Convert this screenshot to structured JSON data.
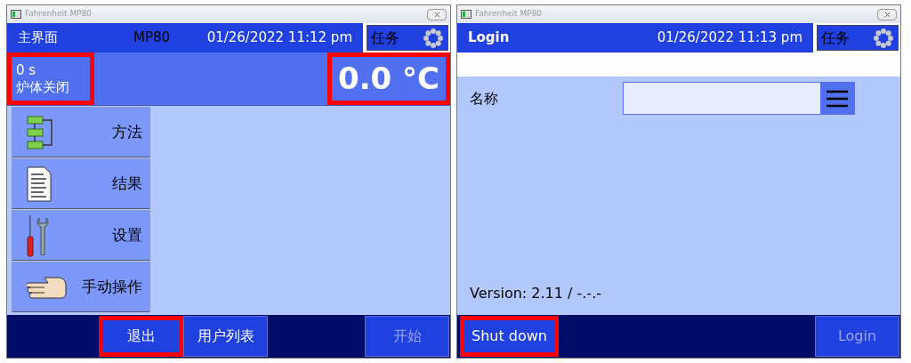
{
  "windows": [
    {
      "kind": "main",
      "title": "Fahrenheit MP80",
      "header": {
        "title": "主界面",
        "device": "MP80",
        "datetime": "01/26/2022 11:12 pm",
        "tasks": "任务"
      },
      "status": {
        "time": "0 s",
        "state": "炉体关闭",
        "temperature": "0.0 °C",
        "time_highlighted": true,
        "temperature_highlighted": true
      },
      "menu": [
        {
          "label": "方法",
          "kind": "flowchart"
        },
        {
          "label": "结果",
          "kind": "document"
        },
        {
          "label": "设置",
          "kind": "tools"
        },
        {
          "label": "手动操作",
          "kind": "hand"
        }
      ],
      "footer": {
        "left": [
          {
            "label": "退出",
            "disabled": false,
            "highlighted": true
          },
          {
            "label": "用户列表",
            "disabled": false,
            "highlighted": false
          }
        ],
        "right": [
          {
            "label": "开始",
            "disabled": true,
            "highlighted": false
          }
        ]
      }
    },
    {
      "kind": "login",
      "title": "Fahrenheit MP80",
      "header": {
        "title": "Login",
        "datetime": "01/26/2022 11:13 pm",
        "tasks": "任务"
      },
      "form": {
        "label": "名称"
      },
      "version": "Version: 2.11 / -.-.-",
      "footer": {
        "left": [
          {
            "label": "Shut down",
            "disabled": false,
            "highlighted": true
          }
        ],
        "right": [
          {
            "label": "Login",
            "disabled": true,
            "highlighted": false
          }
        ]
      }
    }
  ]
}
